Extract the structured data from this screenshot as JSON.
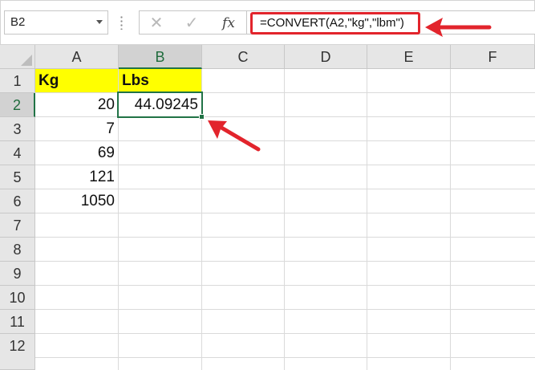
{
  "formula_bar": {
    "name_box": "B2",
    "cancel_icon": "✕",
    "enter_icon": "✓",
    "fx_label": "fx",
    "formula": "=CONVERT(A2,\"kg\",\"lbm\")"
  },
  "columns": [
    "A",
    "B",
    "C",
    "D",
    "E",
    "F"
  ],
  "rows": [
    "1",
    "2",
    "3",
    "4",
    "5",
    "6",
    "7",
    "8",
    "9",
    "10",
    "11",
    "12"
  ],
  "cells": {
    "a1": "Kg",
    "b1": "Lbs",
    "a2": "20",
    "b2": "44.09245",
    "a3": "7",
    "a4": "69",
    "a5": "121",
    "a6": "1050"
  },
  "selected_cell": "B2",
  "colors": {
    "header_fill": "#ffff00",
    "selection": "#217346",
    "annotation": "#e2242c"
  }
}
